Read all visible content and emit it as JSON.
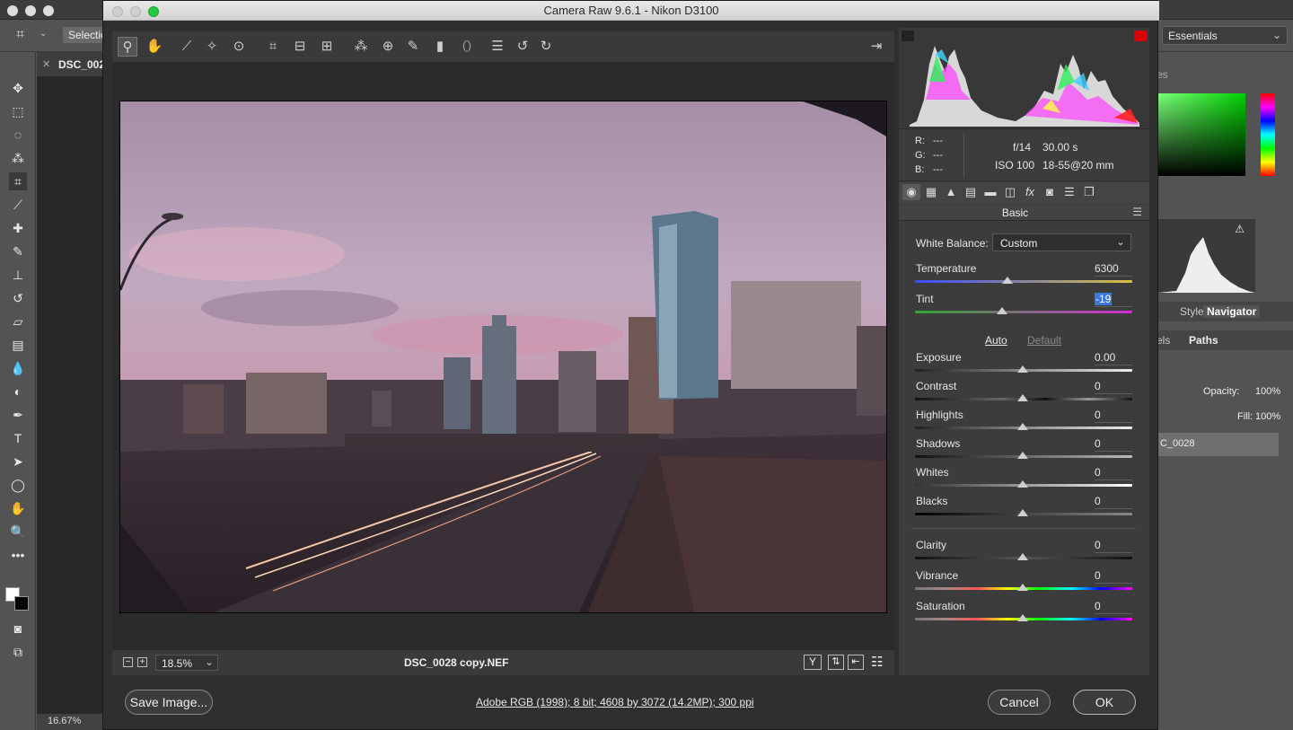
{
  "window": {
    "title": "Camera Raw 9.6.1  -  Nikon D3100"
  },
  "photoshop": {
    "options_selection": "Selectio",
    "doc_tab": "DSC_002",
    "workspace": "Essentials",
    "zoom_status": "16.67%",
    "panel_tabs": {
      "styles": "Styles",
      "navigator": "Navigator",
      "channels": "els",
      "paths": "Paths",
      "swatches_partial": "es"
    },
    "opacity_label": "Opacity:",
    "opacity_value": "100%",
    "fill_label": "Fill:",
    "fill_value": "100%",
    "layer_name": "C_0028"
  },
  "camera_info": {
    "r_label": "R:",
    "r_value": "---",
    "g_label": "G:",
    "g_value": "---",
    "b_label": "B:",
    "b_value": "---",
    "aperture": "f/14",
    "shutter": "30.00 s",
    "iso": "ISO 100",
    "lens": "18-55@20 mm"
  },
  "panel": {
    "title": "Basic",
    "white_balance_label": "White Balance:",
    "white_balance_value": "Custom",
    "auto_label": "Auto",
    "default_label": "Default",
    "sliders": [
      {
        "label": "Temperature",
        "value": "6300"
      },
      {
        "label": "Tint",
        "value": "-19"
      },
      {
        "label": "Exposure",
        "value": "0.00"
      },
      {
        "label": "Contrast",
        "value": "0"
      },
      {
        "label": "Highlights",
        "value": "0"
      },
      {
        "label": "Shadows",
        "value": "0"
      },
      {
        "label": "Whites",
        "value": "0"
      },
      {
        "label": "Blacks",
        "value": "0"
      },
      {
        "label": "Clarity",
        "value": "0"
      },
      {
        "label": "Vibrance",
        "value": "0"
      },
      {
        "label": "Saturation",
        "value": "0"
      }
    ]
  },
  "preview": {
    "zoom": "18.5%",
    "filename": "DSC_0028 copy.NEF",
    "compare_label": "Y"
  },
  "footer": {
    "save_label": "Save Image...",
    "workflow_link": "Adobe RGB (1998); 8 bit; 4608 by 3072 (14.2MP); 300 ppi",
    "cancel_label": "Cancel",
    "ok_label": "OK"
  },
  "colors": {
    "accent": "#2d6fd6",
    "selection": "#3d78d8"
  }
}
